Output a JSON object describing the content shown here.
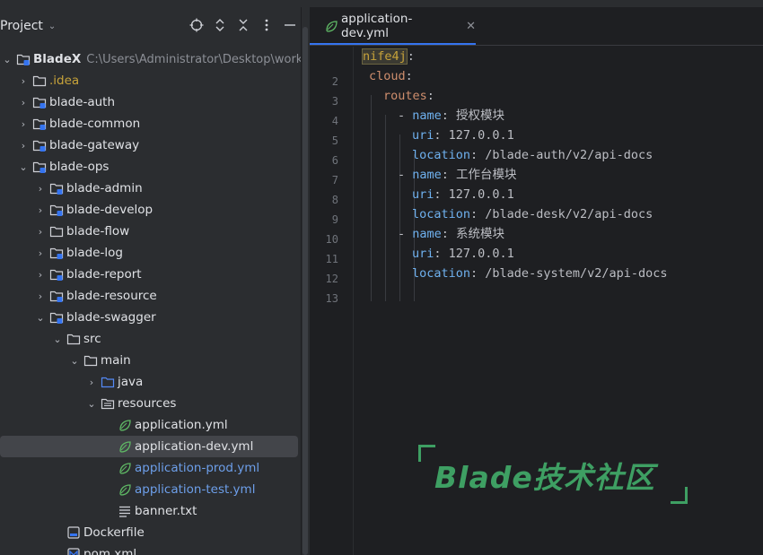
{
  "project_panel": {
    "title": "Project",
    "tree": [
      {
        "label": "BladeX",
        "path": "C:\\Users\\Administrator\\Desktop\\workflow\\BladeX"
      },
      {
        "label": ".idea"
      },
      {
        "label": "blade-auth"
      },
      {
        "label": "blade-common"
      },
      {
        "label": "blade-gateway"
      },
      {
        "label": "blade-ops"
      },
      {
        "label": "blade-admin"
      },
      {
        "label": "blade-develop"
      },
      {
        "label": "blade-flow"
      },
      {
        "label": "blade-log"
      },
      {
        "label": "blade-report"
      },
      {
        "label": "blade-resource"
      },
      {
        "label": "blade-swagger"
      },
      {
        "label": "src"
      },
      {
        "label": "main"
      },
      {
        "label": "java"
      },
      {
        "label": "resources"
      },
      {
        "label": "application.yml"
      },
      {
        "label": "application-dev.yml"
      },
      {
        "label": "application-prod.yml"
      },
      {
        "label": "application-test.yml"
      },
      {
        "label": "banner.txt"
      },
      {
        "label": "Dockerfile"
      },
      {
        "label": "pom.xml"
      }
    ]
  },
  "editor": {
    "tab_label": "application-dev.yml",
    "line_numbers": [
      "2",
      "3",
      "4",
      "5",
      "6",
      "7",
      "8",
      "9",
      "10",
      "11",
      "12",
      "13"
    ],
    "lines": [
      {
        "key": "nife4j",
        "punct": ":"
      },
      {
        "key": "cloud",
        "punct": ":"
      },
      {
        "key": "routes",
        "punct": ":"
      },
      {
        "dash": "- ",
        "key": "name",
        "punct": ": ",
        "value": "授权模块"
      },
      {
        "key": "uri",
        "punct": ": ",
        "value": "127.0.0.1"
      },
      {
        "key": "location",
        "punct": ": ",
        "value": "/blade-auth/v2/api-docs"
      },
      {
        "dash": "- ",
        "key": "name",
        "punct": ": ",
        "value": "工作台模块"
      },
      {
        "key": "uri",
        "punct": ": ",
        "value": "127.0.0.1"
      },
      {
        "key": "location",
        "punct": ": ",
        "value": "/blade-desk/v2/api-docs"
      },
      {
        "dash": "- ",
        "key": "name",
        "punct": ": ",
        "value": "系统模块"
      },
      {
        "key": "uri",
        "punct": ": ",
        "value": "127.0.0.1"
      },
      {
        "key": "location",
        "punct": ": ",
        "value": "/blade-system/v2/api-docs"
      }
    ]
  },
  "watermark": {
    "text": "Blade技术社区"
  },
  "colors": {
    "accent": "#3574f0",
    "yaml_key": "#6fb1ef",
    "watermark": "#3e9f63"
  }
}
